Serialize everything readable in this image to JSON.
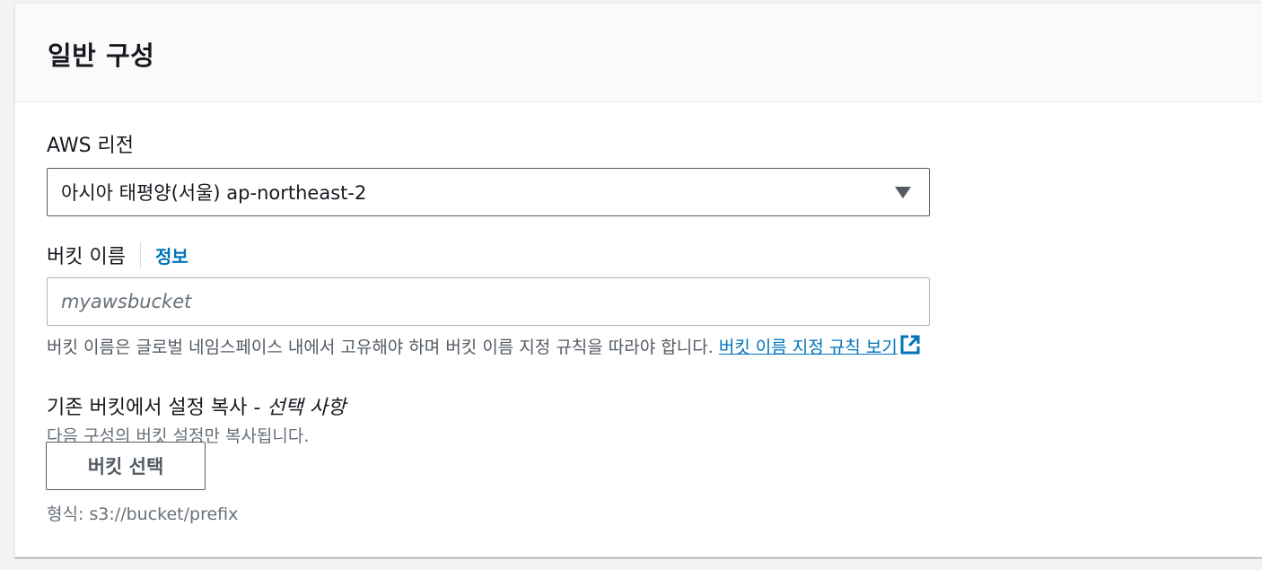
{
  "section": {
    "title": "일반 구성"
  },
  "region": {
    "label": "AWS 리전",
    "selected": "아시아 태평양(서울) ap-northeast-2"
  },
  "bucket_name": {
    "label": "버킷 이름",
    "info_link": "정보",
    "placeholder": "myawsbucket",
    "value": "",
    "constraint_text": "버킷 이름은 글로벌 네임스페이스 내에서 고유해야 하며 버킷 이름 지정 규칙을 따라야 합니다.",
    "rules_link": "버킷 이름 지정 규칙 보기"
  },
  "copy_settings": {
    "label": "기존 버킷에서 설정 복사 -",
    "optional": "선택 사항",
    "description": "다음 구성의 버킷 설정만 복사됩니다.",
    "button_label": "버킷 선택",
    "format_hint": "형식: s3://bucket/prefix"
  },
  "colors": {
    "link": "#0073bb",
    "border": "#545b64",
    "text": "#16191f",
    "secondary_text": "#687078"
  },
  "icons": {
    "select_caret": "caret-down-icon",
    "external_link": "external-link-icon"
  }
}
